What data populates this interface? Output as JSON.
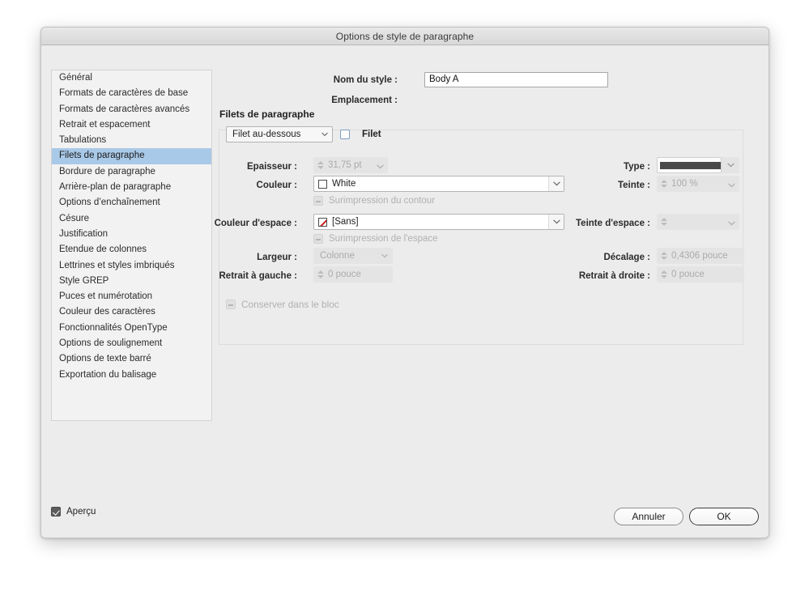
{
  "window": {
    "title": "Options de style de paragraphe"
  },
  "sidebar": {
    "items": [
      {
        "label": "Général",
        "selected": false
      },
      {
        "label": "Formats de caractères de base",
        "selected": false
      },
      {
        "label": "Formats de caractères avancés",
        "selected": false
      },
      {
        "label": "Retrait et espacement",
        "selected": false
      },
      {
        "label": "Tabulations",
        "selected": false
      },
      {
        "label": "Filets de paragraphe",
        "selected": true
      },
      {
        "label": "Bordure de paragraphe",
        "selected": false
      },
      {
        "label": "Arrière-plan de paragraphe",
        "selected": false
      },
      {
        "label": "Options d’enchaînement",
        "selected": false
      },
      {
        "label": "Césure",
        "selected": false
      },
      {
        "label": "Justification",
        "selected": false
      },
      {
        "label": "Etendue de colonnes",
        "selected": false
      },
      {
        "label": "Lettrines et styles imbriqués",
        "selected": false
      },
      {
        "label": "Style GREP",
        "selected": false
      },
      {
        "label": "Puces et numérotation",
        "selected": false
      },
      {
        "label": "Couleur des caractères",
        "selected": false
      },
      {
        "label": "Fonctionnalités OpenType",
        "selected": false
      },
      {
        "label": "Options de soulignement",
        "selected": false
      },
      {
        "label": "Options de texte barré",
        "selected": false
      },
      {
        "label": "Exportation du balisage",
        "selected": false
      }
    ]
  },
  "header": {
    "style_name_label": "Nom du style :",
    "style_name_value": "Body A",
    "location_label": "Emplacement :",
    "location_value": ""
  },
  "section": {
    "title": "Filets de paragraphe",
    "rule_position_value": "Filet au-dessous",
    "rule_checkbox_label": "Filet",
    "rule_checkbox_checked": false
  },
  "fields": {
    "weight_label": "Epaisseur :",
    "weight_value": "31,75 pt",
    "type_label": "Type :",
    "type_value": "",
    "color_label": "Couleur :",
    "color_value": "White",
    "tint_label": "Teinte :",
    "tint_value": "100 %",
    "overprint_stroke_label": "Surimpression du contour",
    "gap_color_label": "Couleur d'espace :",
    "gap_color_value": "[Sans]",
    "gap_tint_label": "Teinte d'espace :",
    "gap_tint_value": "",
    "overprint_gap_label": "Surimpression de l'espace",
    "width_label": "Largeur :",
    "width_value": "Colonne",
    "offset_label": "Décalage :",
    "offset_value": "0,4306 pouce",
    "left_indent_label": "Retrait à gauche :",
    "left_indent_value": "0 pouce",
    "right_indent_label": "Retrait à droite :",
    "right_indent_value": "0 pouce",
    "keep_in_frame_label": "Conserver dans le bloc"
  },
  "footer": {
    "preview_label": "Aperçu",
    "preview_checked": true,
    "cancel_label": "Annuler",
    "ok_label": "OK"
  },
  "colors": {
    "selection": "#a9c9e8",
    "dialog_bg": "#ececec",
    "none_swatch_slash": "#d11a1a",
    "disabled_text": "#aeaeae"
  }
}
